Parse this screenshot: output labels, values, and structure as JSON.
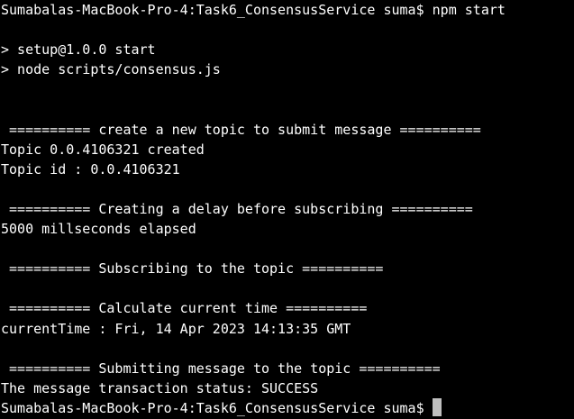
{
  "terminal": {
    "lines": [
      "Sumabalas-MacBook-Pro-4:Task6_ConsensusService suma$ npm start",
      "",
      "> setup@1.0.0 start",
      "> node scripts/consensus.js",
      "",
      "",
      " ========== create a new topic to submit message ==========",
      "Topic 0.0.4106321 created",
      "Topic id : 0.0.4106321",
      "",
      " ========== Creating a delay before subscribing ==========",
      "5000 millseconds elapsed",
      "",
      " ========== Subscribing to the topic ==========",
      "",
      " ========== Calculate current time ==========",
      "currentTime : Fri, 14 Apr 2023 14:13:35 GMT",
      "",
      " ========== Submitting message to the topic ==========",
      "The message transaction status: SUCCESS"
    ],
    "prompt": "Sumabalas-MacBook-Pro-4:Task6_ConsensusService suma$ "
  }
}
